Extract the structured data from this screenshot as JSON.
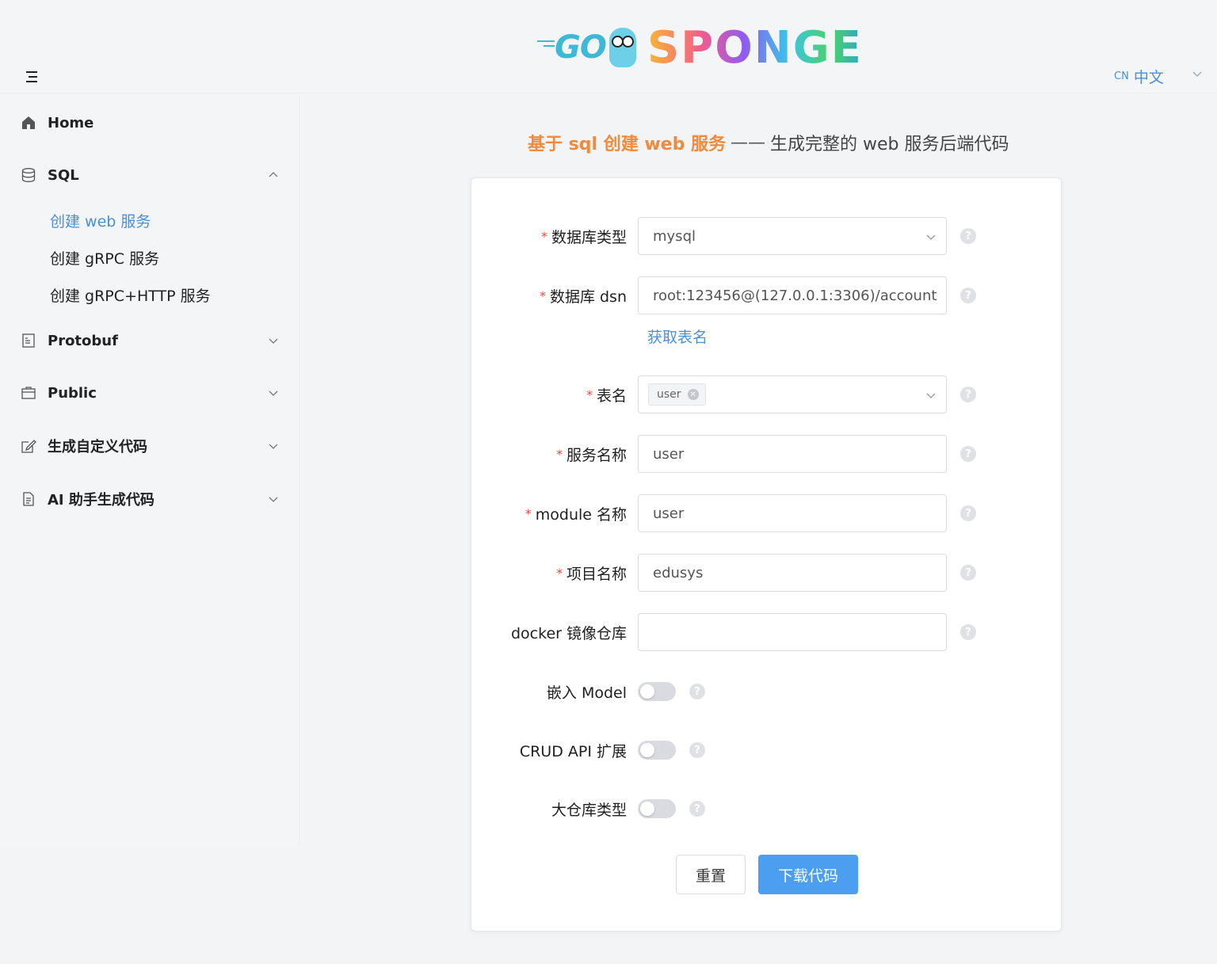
{
  "header": {
    "logo_go": "GO",
    "logo_sponge": "SPONGE",
    "lang_code": "CN",
    "lang_label": "中文"
  },
  "sidebar": {
    "items": [
      {
        "label": "Home",
        "icon": "home-icon"
      },
      {
        "label": "SQL",
        "icon": "database-icon",
        "expanded": true,
        "children": [
          {
            "label": "创建 web 服务",
            "active": true
          },
          {
            "label": "创建 gRPC 服务"
          },
          {
            "label": "创建 gRPC+HTTP 服务"
          }
        ]
      },
      {
        "label": "Protobuf",
        "icon": "document-icon"
      },
      {
        "label": "Public",
        "icon": "briefcase-icon"
      },
      {
        "label": "生成自定义代码",
        "icon": "edit-icon"
      },
      {
        "label": "AI 助手生成代码",
        "icon": "file-icon"
      }
    ]
  },
  "main": {
    "title_accent": "基于 sql 创建 web 服务",
    "title_sep": "——",
    "title_rest": "生成完整的 web 服务后端代码"
  },
  "form": {
    "db_type": {
      "label": "数据库类型",
      "value": "mysql",
      "required": true
    },
    "db_dsn": {
      "label": "数据库 dsn",
      "value": "root:123456@(127.0.0.1:3306)/account",
      "required": true
    },
    "fetch_tables_link": "获取表名",
    "table_name": {
      "label": "表名",
      "tags": [
        "user"
      ],
      "required": true
    },
    "service_name": {
      "label": "服务名称",
      "value": "user",
      "required": true
    },
    "module_name": {
      "label": "module 名称",
      "value": "user",
      "required": true
    },
    "project_name": {
      "label": "项目名称",
      "value": "edusys",
      "required": true
    },
    "docker_repo": {
      "label": "docker 镜像仓库",
      "value": ""
    },
    "embed_model": {
      "label": "嵌入 Model",
      "on": false
    },
    "crud_api": {
      "label": "CRUD API 扩展",
      "on": false
    },
    "mono_repo": {
      "label": "大仓库类型",
      "on": false
    },
    "required_mark": "*",
    "help_glyph": "?",
    "reset_label": "重置",
    "download_label": "下载代码"
  },
  "colors": {
    "accent": "#4a90d9",
    "title_accent": "#f08a3c",
    "primary_button": "#4c9ff0",
    "required": "#f5453a"
  }
}
